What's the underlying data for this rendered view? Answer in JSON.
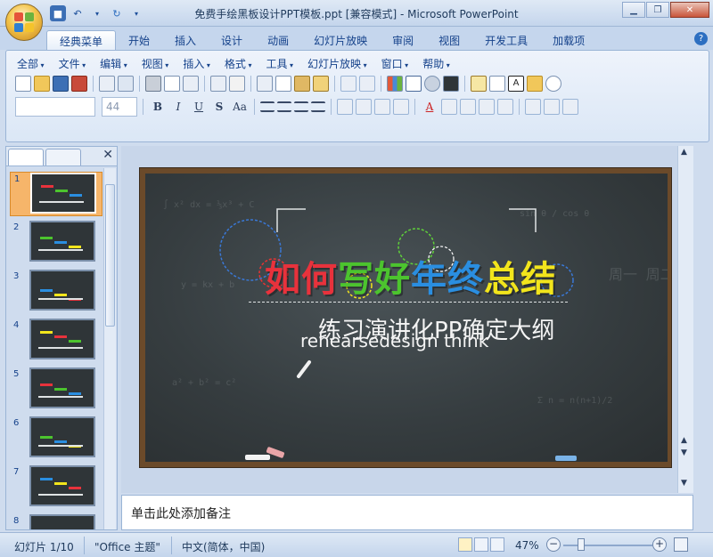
{
  "window": {
    "title": "免费手绘黑板设计PPT模板.ppt [兼容模式] - Microsoft PowerPoint"
  },
  "ribbon_tabs": [
    "经典菜单",
    "开始",
    "插入",
    "设计",
    "动画",
    "幻灯片放映",
    "审阅",
    "视图",
    "开发工具",
    "加载项"
  ],
  "active_tab": 0,
  "classic_menu": [
    "全部",
    "文件",
    "编辑",
    "视图",
    "插入",
    "格式",
    "工具",
    "幻灯片放映",
    "窗口",
    "帮助"
  ],
  "format": {
    "font_name": "",
    "font_size": "44",
    "bold": "B",
    "italic": "I",
    "underline": "U",
    "shadow": "S",
    "change_case": "Aa",
    "font_color_letter": "A"
  },
  "thumbnails": [
    {
      "num": "1"
    },
    {
      "num": "2"
    },
    {
      "num": "3"
    },
    {
      "num": "4"
    },
    {
      "num": "5"
    },
    {
      "num": "6"
    },
    {
      "num": "7"
    },
    {
      "num": "8"
    }
  ],
  "slide": {
    "title_chars": [
      {
        "ch": "如",
        "color": "#e8323c"
      },
      {
        "ch": "何",
        "color": "#e8323c"
      },
      {
        "ch": "写",
        "color": "#4cc42e"
      },
      {
        "ch": "好",
        "color": "#4cc42e"
      },
      {
        "ch": "年",
        "color": "#2a8ee0"
      },
      {
        "ch": "终",
        "color": "#2a8ee0"
      },
      {
        "ch": "总",
        "color": "#f2e51c"
      },
      {
        "ch": "结",
        "color": "#f2e51c"
      }
    ],
    "subtitle_cn": "练习演讲化PP确定大纲",
    "subtitle_en": "rehearsedesign   think"
  },
  "notes": {
    "placeholder": "单击此处添加备注"
  },
  "status": {
    "slide": "幻灯片 1/10",
    "theme": "\"Office 主题\"",
    "language": "中文(简体，中国)",
    "zoom": "47%"
  },
  "colors": {
    "accent": "#15428b",
    "board": "#363d40",
    "selected_thumb": "#f6b56a"
  }
}
